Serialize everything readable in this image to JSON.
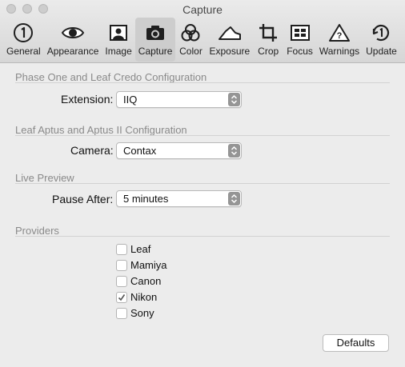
{
  "window": {
    "title": "Capture"
  },
  "toolbar": {
    "items": [
      {
        "label": "General",
        "icon": "number-one-circle-icon",
        "active": false
      },
      {
        "label": "Appearance",
        "icon": "eye-icon",
        "active": false
      },
      {
        "label": "Image",
        "icon": "image-portrait-icon",
        "active": false
      },
      {
        "label": "Capture",
        "icon": "camera-icon",
        "active": true
      },
      {
        "label": "Color",
        "icon": "color-circles-icon",
        "active": false
      },
      {
        "label": "Exposure",
        "icon": "exposure-curve-icon",
        "active": false
      },
      {
        "label": "Crop",
        "icon": "crop-icon",
        "active": false
      },
      {
        "label": "Focus",
        "icon": "focus-icon",
        "active": false
      },
      {
        "label": "Warnings",
        "icon": "warning-triangle-icon",
        "active": false
      },
      {
        "label": "Update",
        "icon": "update-circle-icon",
        "active": false
      }
    ]
  },
  "sections": {
    "phase_one": {
      "heading": "Phase One and Leaf Credo Configuration",
      "extension_label": "Extension:",
      "extension_value": "IIQ"
    },
    "leaf_aptus": {
      "heading": "Leaf Aptus and Aptus II Configuration",
      "camera_label": "Camera:",
      "camera_value": "Contax"
    },
    "live_preview": {
      "heading": "Live Preview",
      "pause_label": "Pause After:",
      "pause_value": "5 minutes"
    },
    "providers": {
      "heading": "Providers",
      "items": [
        {
          "label": "Leaf",
          "checked": false
        },
        {
          "label": "Mamiya",
          "checked": false
        },
        {
          "label": "Canon",
          "checked": false
        },
        {
          "label": "Nikon",
          "checked": true
        },
        {
          "label": "Sony",
          "checked": false
        }
      ]
    }
  },
  "buttons": {
    "defaults": "Defaults"
  },
  "colors": {
    "window_bg": "#ececec",
    "section_heading": "#8a8a8a",
    "popup_caret": "#959595"
  }
}
